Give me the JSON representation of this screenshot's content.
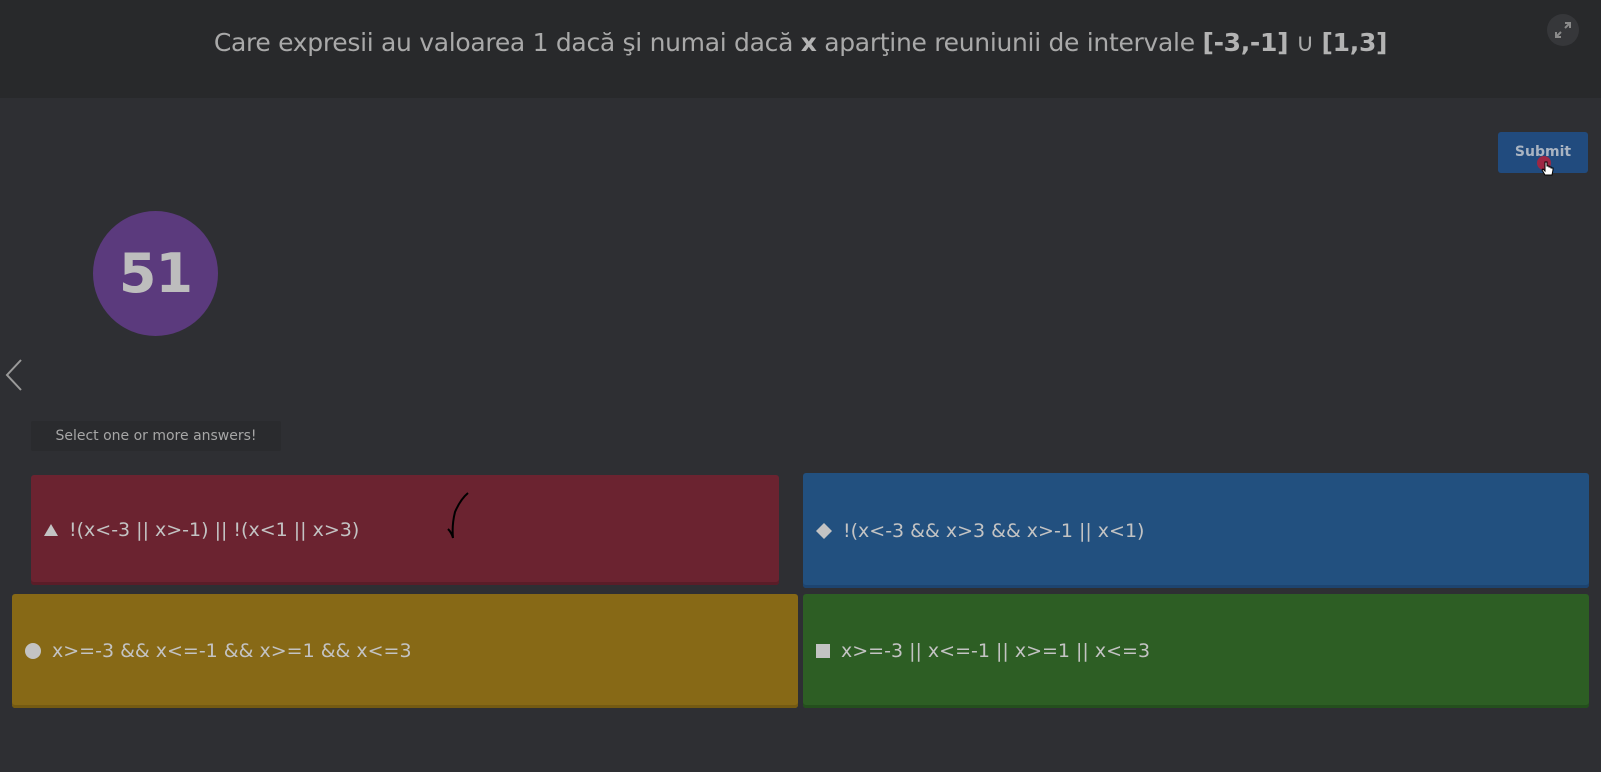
{
  "header": {
    "question_parts": {
      "p1": "Care expresii au valoarea 1 dacă şi numai dacă ",
      "var": "x",
      "p2": " aparţine reuniunii de intervale ",
      "int1": "[-3,-1]",
      "union": " ∪ ",
      "int2": "[1,3]"
    },
    "expand_icon": "expand-icon"
  },
  "submit_label": "Submit",
  "timer_value": "51",
  "hint_text": "Select one or more answers!",
  "answers": [
    {
      "shape": "triangle",
      "text": "!(x<-3 || x>-1) || !(x<1 || x>3)",
      "color": "#6b2330"
    },
    {
      "shape": "diamond",
      "text": "!(x<-3 && x>3 && x>-1 || x<1)",
      "color": "#22507f"
    },
    {
      "shape": "circle",
      "text": "x>=-3 && x<=-1 && x>=1 && x<=3",
      "color": "#876916"
    },
    {
      "shape": "square",
      "text": "x>=-3 || x<=-1 || x>=1 || x<=3",
      "color": "#2d5e24"
    }
  ],
  "colors": {
    "background": "#2e2f33",
    "header": "#28292b",
    "submit": "#214b7e",
    "timer": "#5b3a7d"
  }
}
